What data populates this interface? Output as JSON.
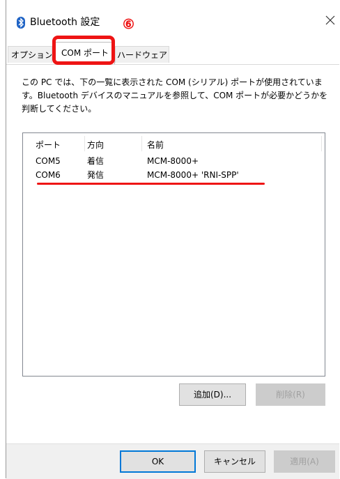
{
  "window": {
    "title": "Bluetooth 設定",
    "close_icon": "close-icon"
  },
  "annotation": {
    "step_number": "⑥",
    "color": "#ee1414"
  },
  "tabs": [
    {
      "label": "オプション"
    },
    {
      "label": "COM ポート",
      "selected": true
    },
    {
      "label": "ハードウェア"
    }
  ],
  "description": "この PC では、下の一覧に表示された COM (シリアル) ポートが使用されています。Bluetooth デバイスのマニュアルを参照して、COM ポートが必要かどうかを判断してください。",
  "list": {
    "columns": [
      "ポート",
      "方向",
      "名前"
    ],
    "rows": [
      {
        "port": "COM5",
        "direction": "着信",
        "name": "MCM-8000+"
      },
      {
        "port": "COM6",
        "direction": "発信",
        "name": "MCM-8000+ 'RNI-SPP'"
      }
    ]
  },
  "buttons": {
    "add": "追加(D)...",
    "remove": "削除(R)",
    "ok": "OK",
    "cancel": "キャンセル",
    "apply": "適用(A)"
  },
  "colors": {
    "accent": "#0078d7",
    "bluetooth": "#1f63c5"
  }
}
